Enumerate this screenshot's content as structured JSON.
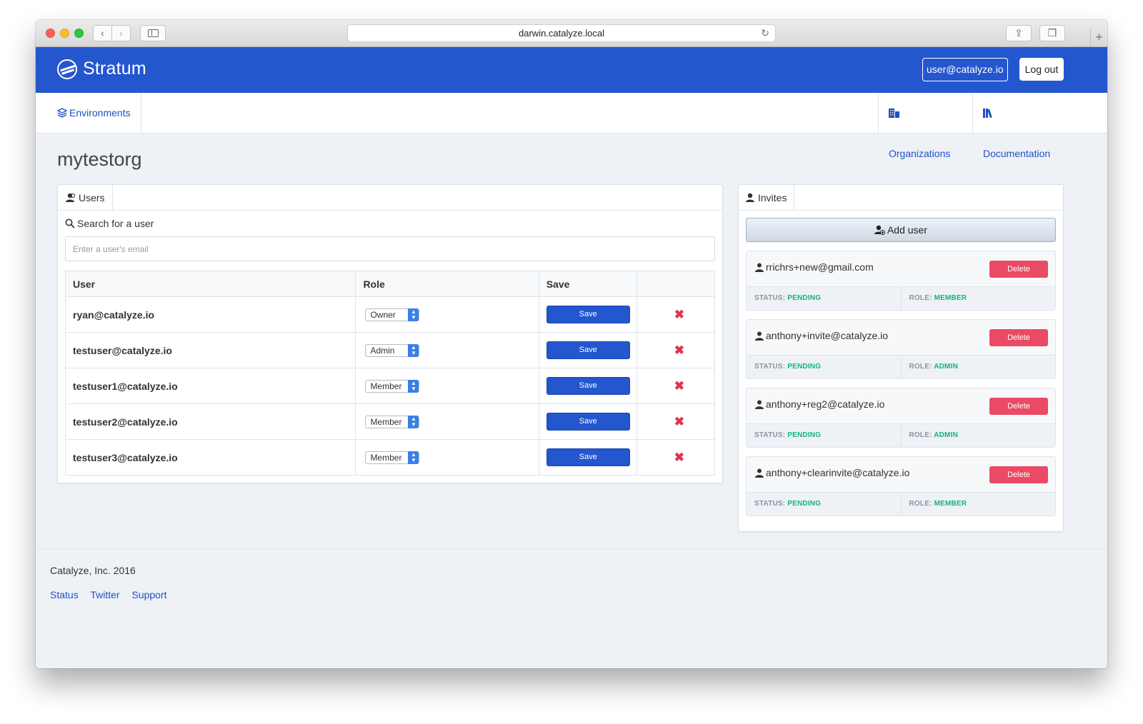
{
  "browser": {
    "url": "darwin.catalyze.local",
    "nav_back_icon": "‹",
    "nav_forward_icon": "›",
    "reload_icon": "↻",
    "share_icon": "⇪",
    "tabs_icon": "❐",
    "new_tab_icon": "+"
  },
  "header": {
    "brand": "Stratum",
    "user_email": "user@catalyze.io",
    "logout_label": "Log out",
    "accent_color": "#2456ce"
  },
  "nav": {
    "environments": "Environments",
    "organizations": "Organizations",
    "documentation": "Documentation"
  },
  "page": {
    "title": "mytestorg"
  },
  "users_panel": {
    "tab_label": "Users",
    "search_label": "Search for a user",
    "search_placeholder": "Enter a user's email",
    "columns": [
      "User",
      "Role",
      "Save",
      ""
    ],
    "save_label": "Save",
    "delete_icon": "✖",
    "rows": [
      {
        "email": "ryan@catalyze.io",
        "role": "Owner"
      },
      {
        "email": "testuser@catalyze.io",
        "role": "Admin"
      },
      {
        "email": "testuser1@catalyze.io",
        "role": "Member"
      },
      {
        "email": "testuser2@catalyze.io",
        "role": "Member"
      },
      {
        "email": "testuser3@catalyze.io",
        "role": "Member"
      }
    ]
  },
  "invites_panel": {
    "tab_label": "Invites",
    "add_user_label": "Add user",
    "delete_label": "Delete",
    "status_prefix": "STATUS:",
    "role_prefix": "ROLE:",
    "status_color": "#17b07e",
    "delete_color": "#ea4a63",
    "invites": [
      {
        "email": "rrichrs+new@gmail.com",
        "status": "PENDING",
        "role": "MEMBER"
      },
      {
        "email": "anthony+invite@catalyze.io",
        "status": "PENDING",
        "role": "ADMIN"
      },
      {
        "email": "anthony+reg2@catalyze.io",
        "status": "PENDING",
        "role": "ADMIN"
      },
      {
        "email": "anthony+clearinvite@catalyze.io",
        "status": "PENDING",
        "role": "MEMBER"
      }
    ]
  },
  "footer": {
    "copyright": "Catalyze, Inc. 2016",
    "links": [
      "Status",
      "Twitter",
      "Support"
    ]
  }
}
